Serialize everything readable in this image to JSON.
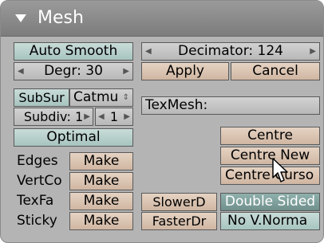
{
  "panel": {
    "title": "Mesh"
  },
  "auto_smooth": {
    "label": "Auto Smooth"
  },
  "degr": {
    "label": "Degr: 30"
  },
  "decimator": {
    "label": "Decimator: 124"
  },
  "apply": {
    "label": "Apply"
  },
  "cancel": {
    "label": "Cancel"
  },
  "subsurf": {
    "label": "SubSur",
    "type_label": "Catmu"
  },
  "subdiv": {
    "label": "Subdiv: 1",
    "render_label": "1"
  },
  "optimal": {
    "label": "Optimal"
  },
  "texmesh": {
    "label": "TexMesh:"
  },
  "rows": [
    {
      "label": "Edges",
      "button": "Make"
    },
    {
      "label": "VertCo",
      "button": "Make"
    },
    {
      "label": "TexFa",
      "button": "Make"
    },
    {
      "label": "Sticky",
      "button": "Make"
    }
  ],
  "centre": {
    "centre": "Centre",
    "centre_new": "Centre New",
    "centre_cursor": "Centre Curso"
  },
  "slower": {
    "label": "SlowerD"
  },
  "faster": {
    "label": "FasterDr"
  },
  "double_sided": {
    "label": "Double Sided"
  },
  "no_vnormal": {
    "label": "No V.Norma"
  },
  "colors": {
    "teal": "#a7c4bf",
    "tan": "#cfb6a2",
    "grey": "#b8b8b8",
    "dark_teal": "#6f908c"
  }
}
